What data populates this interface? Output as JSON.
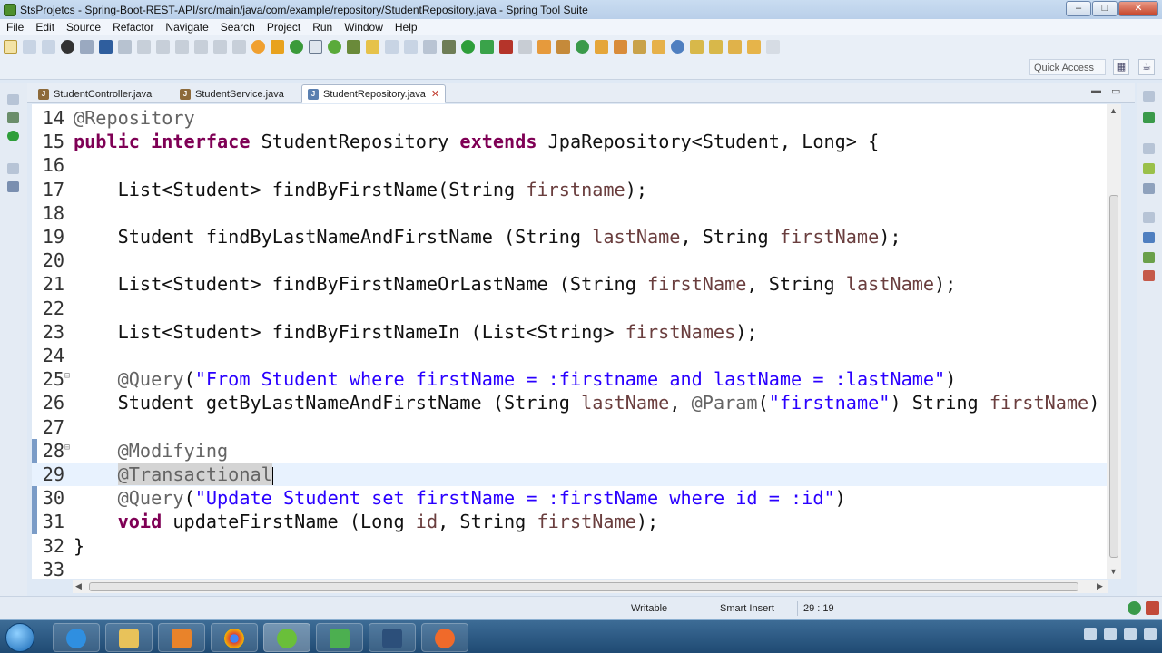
{
  "window": {
    "title": "StsProjetcs - Spring-Boot-REST-API/src/main/java/com/example/repository/StudentRepository.java - Spring Tool Suite",
    "minimize": "–",
    "maximize": "□",
    "close": "✕"
  },
  "menu": [
    "File",
    "Edit",
    "Source",
    "Refactor",
    "Navigate",
    "Search",
    "Project",
    "Run",
    "Window",
    "Help"
  ],
  "toolbar": {
    "quick_access": "Quick Access"
  },
  "tabs": [
    {
      "label": "StudentController.java",
      "active": false
    },
    {
      "label": "StudentService.java",
      "active": false
    },
    {
      "label": "StudentRepository.java",
      "active": true
    }
  ],
  "editor": {
    "lines": [
      {
        "n": "14",
        "text": "@Repository"
      },
      {
        "n": "15",
        "text": "public interface StudentRepository extends JpaRepository<Student, Long> {"
      },
      {
        "n": "16",
        "text": ""
      },
      {
        "n": "17",
        "text": "    List<Student> findByFirstName(String firstname);"
      },
      {
        "n": "18",
        "text": ""
      },
      {
        "n": "19",
        "text": "    Student findByLastNameAndFirstName (String lastName, String firstName);"
      },
      {
        "n": "20",
        "text": ""
      },
      {
        "n": "21",
        "text": "    List<Student> findByFirstNameOrLastName (String firstName, String lastName);"
      },
      {
        "n": "22",
        "text": ""
      },
      {
        "n": "23",
        "text": "    List<Student> findByFirstNameIn (List<String> firstNames);"
      },
      {
        "n": "24",
        "text": ""
      },
      {
        "n": "25",
        "text": "    @Query(\"From Student where firstName = :firstname and lastName = :lastName\")"
      },
      {
        "n": "26",
        "text": "    Student getByLastNameAndFirstName (String lastName, @Param(\"firstname\") String firstName)"
      },
      {
        "n": "27",
        "text": ""
      },
      {
        "n": "28",
        "text": "    @Modifying"
      },
      {
        "n": "29",
        "text": "    @Transactional"
      },
      {
        "n": "30",
        "text": "    @Query(\"Update Student set firstName = :firstName where id = :id\")"
      },
      {
        "n": "31",
        "text": "    void updateFirstName (Long id, String firstName);"
      },
      {
        "n": "32",
        "text": "}"
      },
      {
        "n": "33",
        "text": ""
      }
    ],
    "current_line": "29"
  },
  "status": {
    "writable": "Writable",
    "insert_mode": "Smart Insert",
    "position": "29 : 19"
  },
  "colors": {
    "keyword": "#7f0055",
    "annotation": "#646464",
    "string": "#2a00ff",
    "variable": "#6a3e3e",
    "current_line": "#e8f2fe"
  }
}
